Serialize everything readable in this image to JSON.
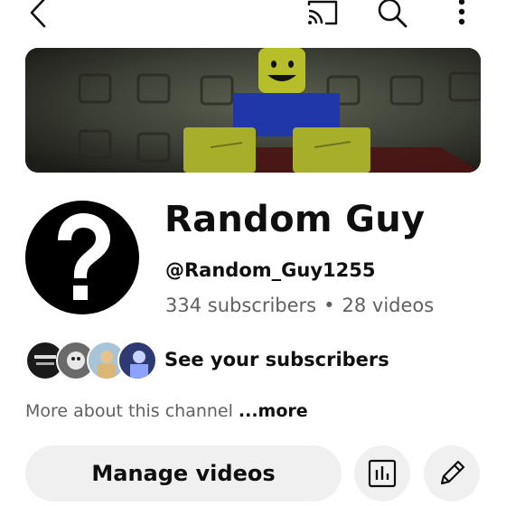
{
  "topbar": {
    "icons": [
      "back-arrow-icon",
      "cast-icon",
      "search-icon",
      "more-vert-icon"
    ]
  },
  "channel": {
    "name": "Random Guy",
    "handle": "@Random_Guy1255",
    "subscribers": "334 subscribers",
    "separator": "•",
    "videos": "28 videos"
  },
  "subscribers_preview": {
    "label": "See your subscribers"
  },
  "about": {
    "text": "More about this channel",
    "more_link": "...more"
  },
  "actions": {
    "manage_videos": "Manage videos"
  },
  "colors": {
    "text_primary": "#0f0f0f",
    "text_secondary": "#606060",
    "button_bg": "#f0f0f0"
  }
}
